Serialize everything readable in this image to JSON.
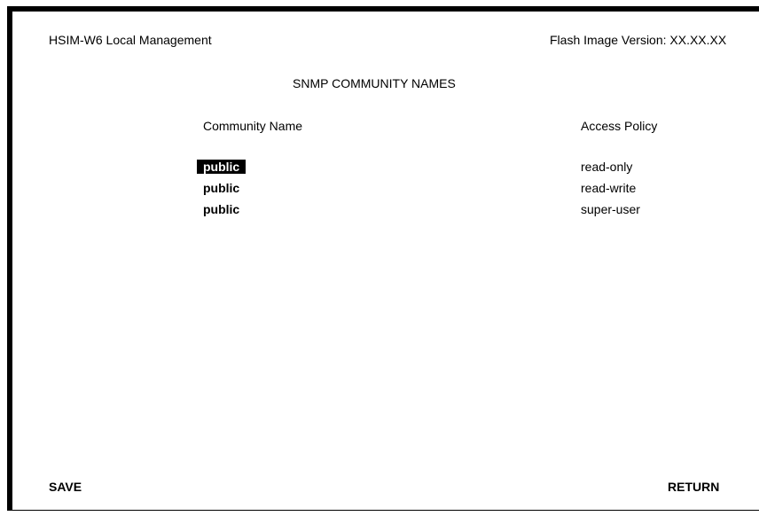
{
  "header": {
    "title": "HSIM-W6 Local Management",
    "version": "Flash Image Version: XX.XX.XX"
  },
  "screen": {
    "title": "SNMP COMMUNITY NAMES"
  },
  "table": {
    "columns": [
      "Community Name",
      "Access Policy"
    ],
    "rows": [
      {
        "community_name": "public",
        "access_policy": "read-only",
        "selected": true
      },
      {
        "community_name": "public",
        "access_policy": "read-write",
        "selected": false
      },
      {
        "community_name": "public",
        "access_policy": "super-user",
        "selected": false
      }
    ]
  },
  "commands": {
    "save": "SAVE",
    "return": "RETURN"
  },
  "colors": {
    "background": "#ffffff",
    "text": "#000000",
    "highlight_background": "#000000",
    "highlight_text": "#ffffff"
  }
}
